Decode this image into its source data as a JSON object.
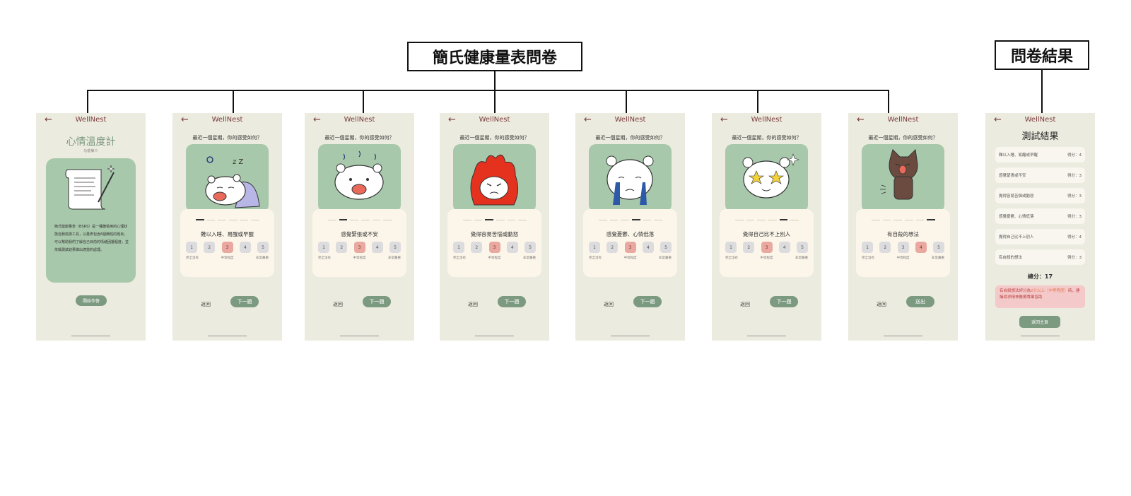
{
  "headings": {
    "survey": "簡氏健康量表問卷",
    "result": "問卷結果"
  },
  "app_name": "WellNest",
  "back_arrow": "←",
  "intro": {
    "title": "心情溫度計",
    "subtitle": "功能簡介",
    "description": "簡式健康量表（BSRS）是一種篩檢用的心理狀態自我檢測工具，以量表包含6個簡短的題目，可以幫助我們了解自己目前的情緒困擾程度，並依據測試結果做出適當的處理。",
    "start_label": "開始作答"
  },
  "question_prompt": "最近一個星期，你的感受如何？",
  "scale_options": [
    "1",
    "2",
    "3",
    "4",
    "5"
  ],
  "scale_labels": [
    "完全沒有",
    "中等程度",
    "非常嚴重"
  ],
  "nav": {
    "back": "返回",
    "next": "下一題",
    "submit": "送出"
  },
  "questions": [
    {
      "text": "難以入睡、易醒或早醒",
      "selected": 3,
      "step": 1,
      "illustration": "sleeping-bear"
    },
    {
      "text": "感覺緊張或不安",
      "selected": 3,
      "step": 2,
      "illustration": "nervous-bear"
    },
    {
      "text": "覺得容易苦惱或動怒",
      "selected": 3,
      "step": 3,
      "illustration": "angry-bear"
    },
    {
      "text": "感覺憂鬱、心情低落",
      "selected": 3,
      "step": 4,
      "illustration": "crying-bear"
    },
    {
      "text": "覺得自己比不上別人",
      "selected": 3,
      "step": 5,
      "illustration": "star-eyes-bear"
    },
    {
      "text": "有自殺的想法",
      "selected": 4,
      "step": 6,
      "illustration": "cat"
    }
  ],
  "result": {
    "title": "測試結果",
    "items": [
      {
        "label": "難以入睡、易醒或早醒",
        "score": "得分：4"
      },
      {
        "label": "感覺緊張或不安",
        "score": "得分：3"
      },
      {
        "label": "覺得容易苦惱或動怒",
        "score": "得分：3"
      },
      {
        "label": "感覺憂鬱、心情低落",
        "score": "得分：3"
      },
      {
        "label": "覺得自己比不上別人",
        "score": "得分：4"
      },
      {
        "label": "有自殺的想法",
        "score": "得分：3"
      }
    ],
    "total": "總分：17",
    "warning_prefix": "有自殺想法評分為",
    "warning_highlight": "2分以上（中等程度）",
    "warning_suffix": "時，建議尋求精神醫療專業協助",
    "home_label": "返回主頁"
  },
  "colors": {
    "accent_green": "#7c9a80",
    "panel_green": "#a8c8ab",
    "selected_option": "#e9a9a0",
    "warning_bg": "#f4c9c9",
    "phone_bg": "#ecebdf"
  }
}
